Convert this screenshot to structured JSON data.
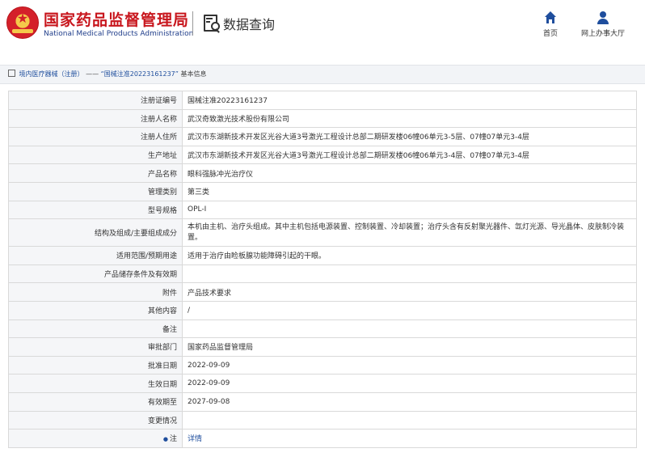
{
  "header": {
    "brand_cn": "国家药品监督管理局",
    "brand_en": "National Medical Products Administration",
    "query_title": "数据查询",
    "nav": [
      {
        "label": "首页",
        "icon": "home-icon"
      },
      {
        "label": "网上办事大厅",
        "icon": "user-icon"
      }
    ]
  },
  "breadcrumb": {
    "root": "境内医疗器械（注册）",
    "sep": "——",
    "current": "“国械注准20223161237”",
    "tail": "基本信息"
  },
  "record": {
    "rows": [
      {
        "label": "注册证编号",
        "value": "国械注准20223161237"
      },
      {
        "label": "注册人名称",
        "value": "武汉奇致激光技术股份有限公司"
      },
      {
        "label": "注册人住所",
        "value": "武汉市东湖新技术开发区光谷大道3号激光工程设计总部二期研发楼06幢06单元3-5层、07幢07单元3-4层"
      },
      {
        "label": "生产地址",
        "value": "武汉市东湖新技术开发区光谷大道3号激光工程设计总部二期研发楼06幢06单元3-4层、07幢07单元3-4层"
      },
      {
        "label": "产品名称",
        "value": "眼科强脉冲光治疗仪"
      },
      {
        "label": "管理类别",
        "value": "第三类"
      },
      {
        "label": "型号规格",
        "value": "OPL-Ⅰ"
      },
      {
        "label": "结构及组成/主要组成成分",
        "value": "本机由主机、治疗头组成。其中主机包括电源装置、控制装置、冷却装置；治疗头含有反射聚光器件、氙灯光源、导光晶体、皮肤制冷装置。"
      },
      {
        "label": "适用范围/预期用途",
        "value": "适用于治疗由睑板腺功能障碍引起的干眼。"
      },
      {
        "label": "产品储存条件及有效期",
        "value": ""
      },
      {
        "label": "附件",
        "value": "产品技术要求"
      },
      {
        "label": "其他内容",
        "value": "/"
      },
      {
        "label": "备注",
        "value": ""
      },
      {
        "label": "审批部门",
        "value": "国家药品监督管理局"
      },
      {
        "label": "批准日期",
        "value": "2022-09-09"
      },
      {
        "label": "生效日期",
        "value": "2022-09-09"
      },
      {
        "label": "有效期至",
        "value": "2027-09-08"
      },
      {
        "label": "变更情况",
        "value": ""
      },
      {
        "label": "注",
        "value": "详情"
      }
    ],
    "note_marker": "●"
  },
  "colors": {
    "brand_red": "#c8161d",
    "brand_blue": "#1f3d8a",
    "link_blue": "#1f4e9d",
    "label_bg": "#f5f6f8",
    "border": "#d9d9d9"
  }
}
